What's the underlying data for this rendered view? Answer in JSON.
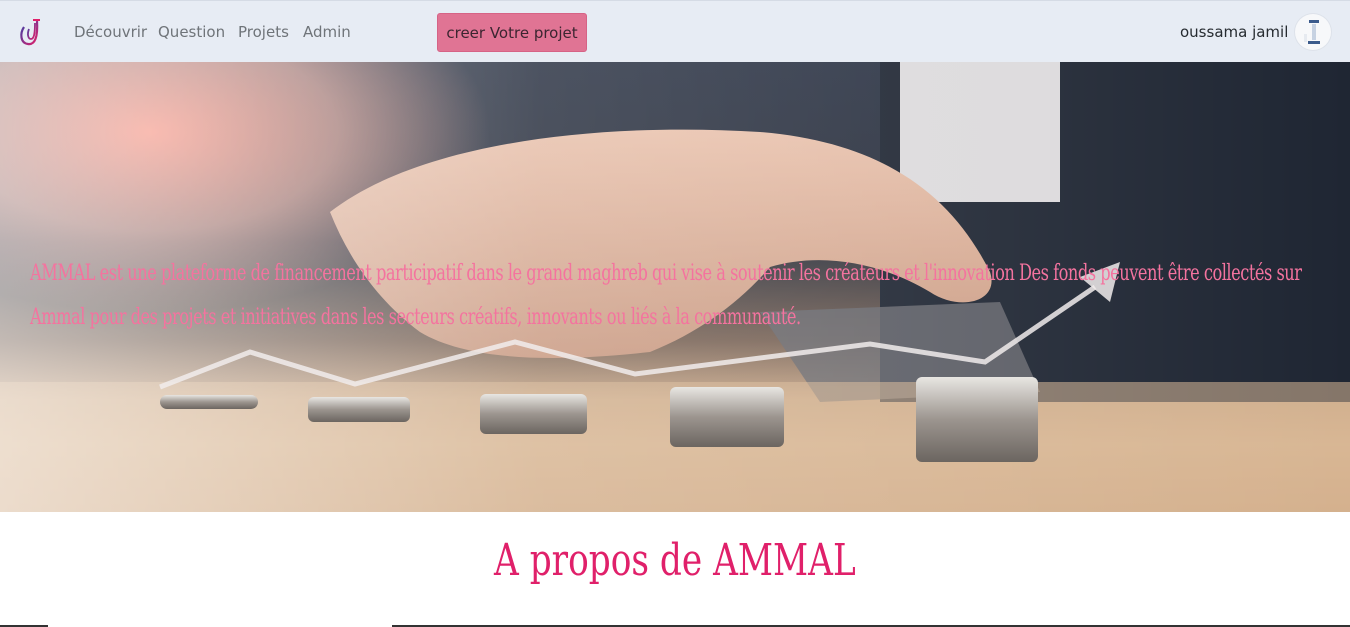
{
  "navbar": {
    "logo_icon": "ammal-logo-icon",
    "links": [
      "Découvrir",
      "Question",
      "Projets",
      "Admin"
    ],
    "create_button": "creer Votre projet",
    "username": "oussama jamil",
    "avatar_icon": "user-avatar-icon"
  },
  "hero": {
    "text": "AMMAL est une plateforme de financement participatif dans le grand maghreb qui vise à soutenir les créateurs et l'innovation Des fonds peuvent être collectés sur Ammal pour des projets et initiatives dans les secteurs créatifs, innovants ou liés à la communauté.",
    "image_icon": "coins-growth-photo"
  },
  "about": {
    "title": "A propos de AMMAL"
  },
  "colors": {
    "navbar_bg": "#e7ecf4",
    "button_bg": "#e07494",
    "hero_text": "#f4739f",
    "title": "#e0206a"
  }
}
